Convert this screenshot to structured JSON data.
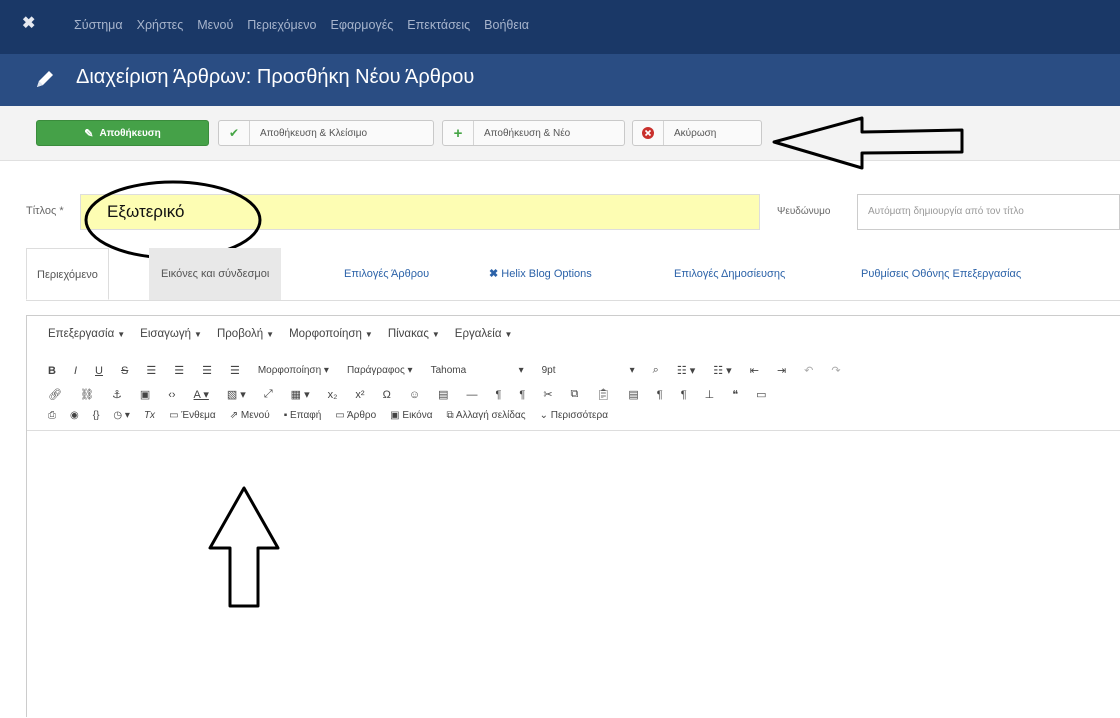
{
  "topbar": {
    "logo": "joomla-logo",
    "menu": [
      "Σύστημα",
      "Χρήστες",
      "Μενού",
      "Περιεχόμενο",
      "Εφαρμογές",
      "Επεκτάσεις",
      "Βοήθεια"
    ]
  },
  "header": {
    "title": "Διαχείριση Άρθρων: Προσθήκη Νέου Άρθρου"
  },
  "toolbar": {
    "save": "Αποθήκευση",
    "save_close": "Αποθήκευση & Κλείσιμο",
    "save_new": "Αποθήκευση & Νέο",
    "cancel": "Ακύρωση"
  },
  "form": {
    "title_label": "Τίτλος *",
    "title_value": "Εξωτερικό",
    "alias_label": "Ψευδώνυμο",
    "alias_placeholder": "Αυτόματη δημιουργία από τον τίτλο"
  },
  "tabs": [
    "Περιεχόμενο",
    "Εικόνες και σύνδεσμοι",
    "Επιλογές Άρθρου",
    "Helix Blog Options",
    "Επιλογές Δημοσίευσης",
    "Ρυθμίσεις Οθόνης Επεξεργασίας"
  ],
  "editor": {
    "menu": [
      "Επεξεργασία",
      "Εισαγωγή",
      "Προβολή",
      "Μορφοποίηση",
      "Πίνακας",
      "Εργαλεία"
    ],
    "format_select": "Μορφοποίηση",
    "paragraph_select": "Παράγραφος",
    "font_select": "Tahoma",
    "size_select": "9pt",
    "buttons": [
      "Ένθεμα",
      "Μενού",
      "Επαφή",
      "Άρθρο",
      "Εικόνα",
      "Αλλαγή σελίδας",
      "Περισσότερα"
    ]
  },
  "colors": {
    "topbar": "#1a3867",
    "header": "#2a4d83",
    "save_button": "#45a148",
    "title_input_bg": "#fdfdb3"
  }
}
